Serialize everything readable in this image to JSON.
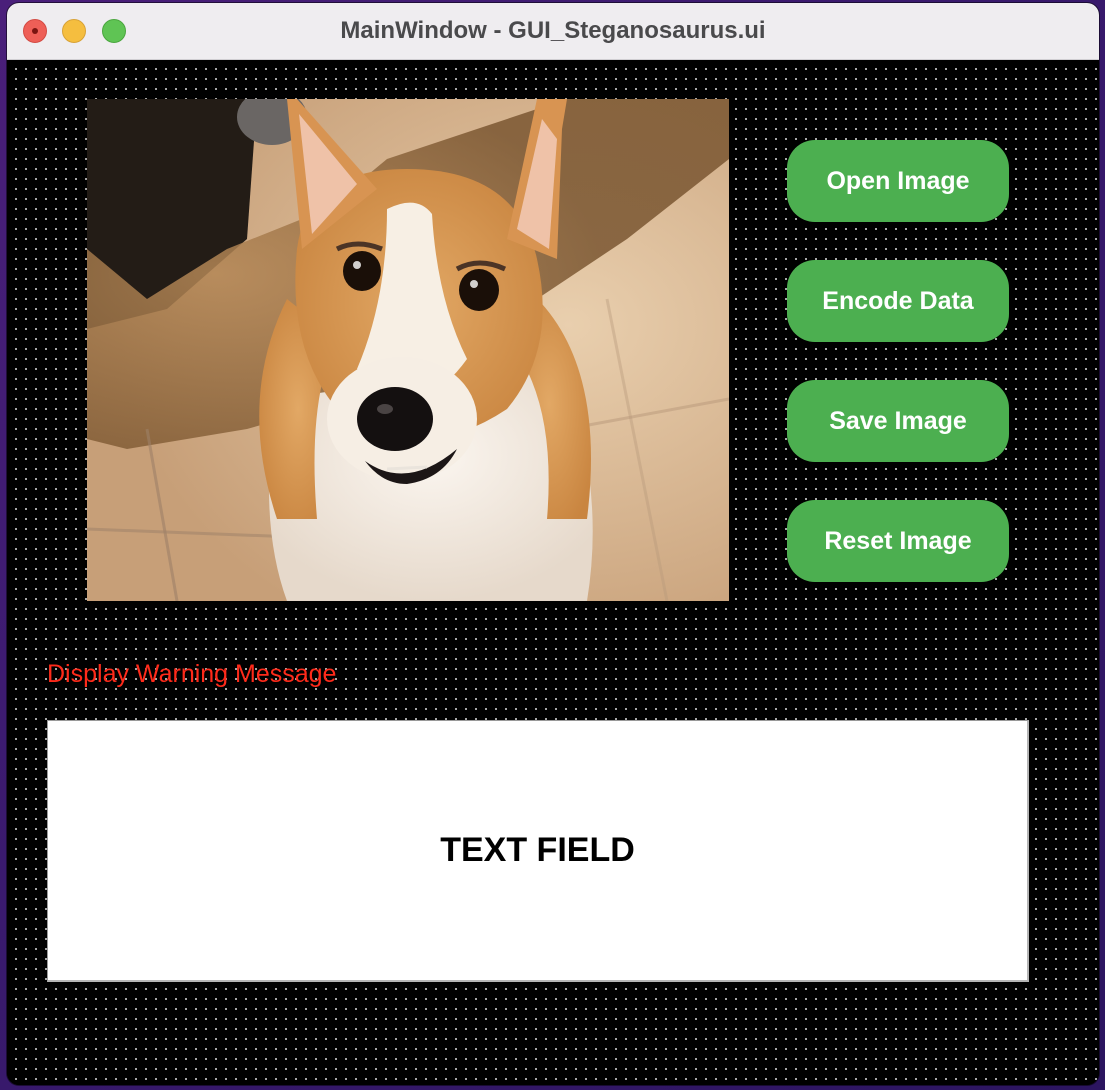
{
  "window": {
    "title": "MainWindow - GUI_Steganosaurus.ui"
  },
  "buttons": {
    "open_image": "Open Image",
    "encode_data": "Encode Data",
    "save_image": "Save Image",
    "reset_image": "Reset Image"
  },
  "warning": {
    "text": "Display Warning Message",
    "color": "#ff2a1a"
  },
  "text_field": {
    "text": "TEXT FIELD"
  },
  "image": {
    "subject": "corgi-dog-photo"
  },
  "colors": {
    "button_bg": "#4caf50",
    "window_bg": "#000000",
    "titlebar_bg": "#efedf0"
  }
}
